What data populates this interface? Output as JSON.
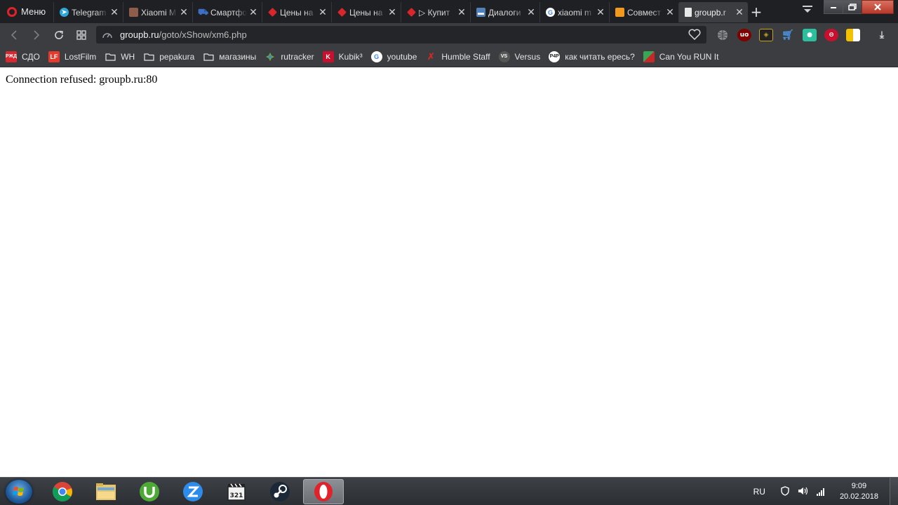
{
  "browser": {
    "menu_label": "Меню",
    "tabs": [
      {
        "label": "Telegram",
        "icon": "telegram-icon",
        "color": "#2ea6da",
        "active": false
      },
      {
        "label": "Xiaomi M",
        "icon": "forum-avatar-icon",
        "color": "#8e5c4a",
        "active": false
      },
      {
        "label": "Смартфо",
        "icon": "cart-icon",
        "color": "#3d6fc7",
        "active": false
      },
      {
        "label": "Цены на",
        "icon": "red-tag-icon",
        "color": "#d8262c",
        "active": false
      },
      {
        "label": "Цены на",
        "icon": "red-tag-icon",
        "color": "#d8262c",
        "active": false
      },
      {
        "label": "▷ Купит",
        "icon": "red-tag-icon",
        "color": "#d8262c",
        "active": false
      },
      {
        "label": "Диалоги",
        "icon": "chat-icon",
        "color": "#5181b8",
        "active": false
      },
      {
        "label": "xiaomi m",
        "icon": "google-icon",
        "color": "#ffffff",
        "active": false
      },
      {
        "label": "Совмест",
        "icon": "box-icon",
        "color": "#f29a1c",
        "active": false
      },
      {
        "label": "groupb.r",
        "icon": "page-icon",
        "color": "#cfcfcf",
        "active": true
      }
    ],
    "address": {
      "host": "groupb.ru",
      "path": "/goto/xShow/xm6.php"
    },
    "bookmarks": [
      {
        "label": "СДО",
        "icon": "rzd-icon",
        "color": "#d7282f"
      },
      {
        "label": "LostFilm",
        "icon": "lostfilm-icon",
        "color": "#e53b2c"
      },
      {
        "label": "WH",
        "icon": "folder-icon",
        "color": ""
      },
      {
        "label": "pepakura",
        "icon": "folder-icon",
        "color": ""
      },
      {
        "label": "магазины",
        "icon": "folder-icon",
        "color": ""
      },
      {
        "label": "rutracker",
        "icon": "rutracker-icon",
        "color": "#6aa84f"
      },
      {
        "label": "Kubik³",
        "icon": "kubik-icon",
        "color": "#c8102e"
      },
      {
        "label": "youtube",
        "icon": "google-icon",
        "color": "#ffffff"
      },
      {
        "label": "Humble Staff",
        "icon": "humble-icon",
        "color": "#cc2929"
      },
      {
        "label": "Versus",
        "icon": "versus-icon",
        "color": "#555555"
      },
      {
        "label": "как читать ересь?",
        "icon": "p4p-icon",
        "color": "#ffffff"
      },
      {
        "label": "Can You RUN It",
        "icon": "canyourunit-icon",
        "color": "#3aa655"
      }
    ]
  },
  "page": {
    "message": "Connection refused: groupb.ru:80"
  },
  "taskbar": {
    "apps": [
      "chrome-icon",
      "explorer-icon",
      "utorrent-icon",
      "zoom-icon",
      "media-player-icon",
      "steam-icon",
      "opera-icon"
    ],
    "language": "RU",
    "time": "9:09",
    "date": "20.02.2018"
  }
}
